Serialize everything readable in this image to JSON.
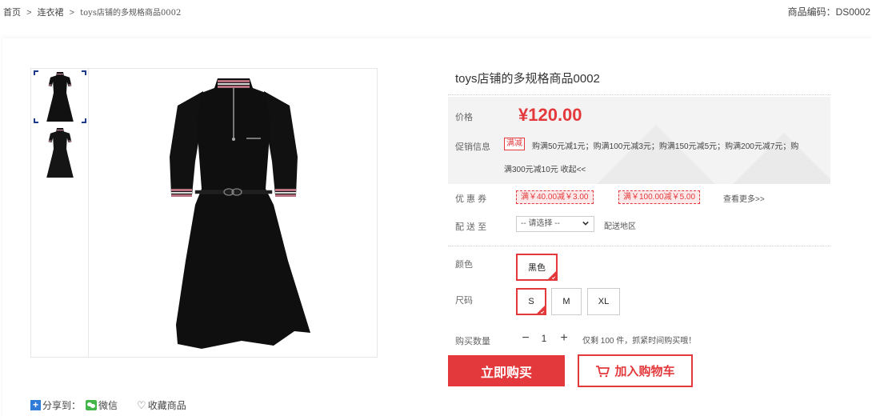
{
  "breadcrumb": {
    "home": "首页",
    "separator": ">",
    "category": "连衣裙",
    "current": "toys店铺的多规格商品0002"
  },
  "sku": "商品编码：DS0002",
  "product": {
    "title": "toys店铺的多规格商品0002",
    "price_label": "价格",
    "price": "¥120.00",
    "promo_label": "促销信息",
    "promo_tag": "满减",
    "promo_line1": "购满50元减1元；购满100元减3元；购满150元减5元；购满200元减7元；购",
    "promo_line2": "满300元减10元 收起<<"
  },
  "coupons": {
    "label": "优 惠 券",
    "items": [
      "满￥40.00减￥3.00",
      "满￥100.00减￥5.00"
    ],
    "more": "查看更多>>"
  },
  "delivery": {
    "label": "配 送 至",
    "placeholder": "-- 请选择 --",
    "region_text": "配送地区"
  },
  "options": {
    "color_label": "颜色",
    "colors": [
      "黑色"
    ],
    "size_label": "尺码",
    "sizes": [
      "S",
      "M",
      "XL"
    ]
  },
  "quantity": {
    "label": "购买数量",
    "minus": "−",
    "value": "1",
    "plus": "+",
    "stock_text": "仅剩 100 件，抓紧时间购买哦！"
  },
  "actions": {
    "buy_now": "立即购买",
    "add_to_cart": "加入购物车"
  },
  "share": {
    "label": "分享到：",
    "wechat": "微信",
    "favorite": "收藏商品"
  },
  "colors": {
    "accent": "#e4393c",
    "panel_bg": "#f3f3f3"
  },
  "icons": [
    "share-plus-icon",
    "wechat-icon",
    "heart-icon",
    "cart-icon",
    "chevron-down-icon"
  ]
}
